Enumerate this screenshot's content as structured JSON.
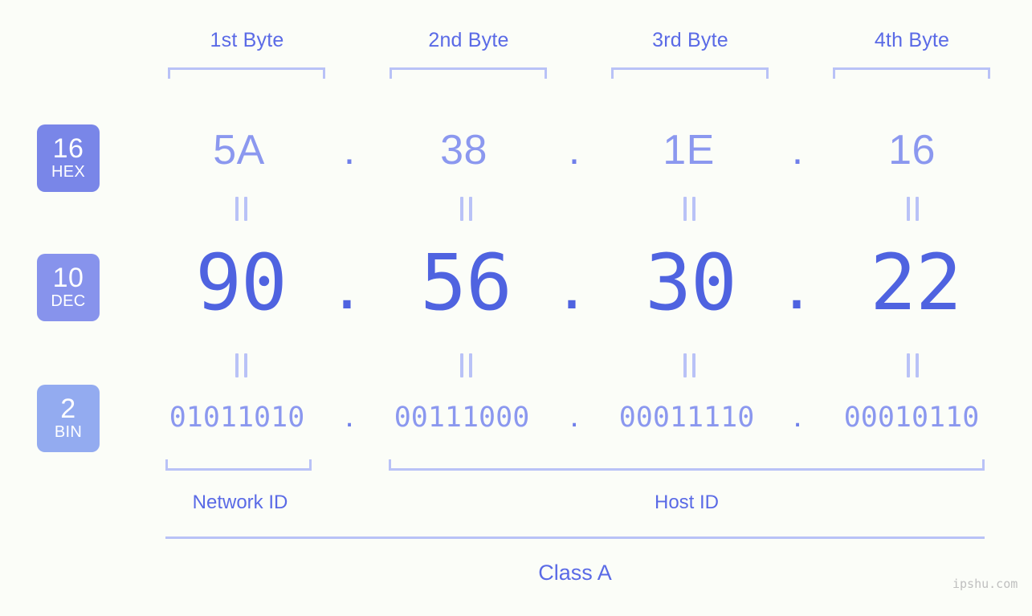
{
  "page": {
    "background_color": "#fbfdf8",
    "accent_color": "#5a6ae6",
    "muted_accent_color": "#8b98ef",
    "bracket_color": "#b9c2f7"
  },
  "byte_headers": [
    {
      "label": "1st Byte"
    },
    {
      "label": "2nd Byte"
    },
    {
      "label": "3rd Byte"
    },
    {
      "label": "4th Byte"
    }
  ],
  "rows": {
    "hex": {
      "badge_number": "16",
      "badge_system": "HEX",
      "badge_color": "#7986e8",
      "octets": [
        "5A",
        "38",
        "1E",
        "16"
      ],
      "separator": "."
    },
    "dec": {
      "badge_number": "10",
      "badge_system": "DEC",
      "badge_color": "#8793ec",
      "octets": [
        "90",
        "56",
        "30",
        "22"
      ],
      "separator": "."
    },
    "bin": {
      "badge_number": "2",
      "badge_system": "BIN",
      "badge_color": "#93abf0",
      "octets": [
        "01011010",
        "00111000",
        "00011110",
        "00010110"
      ],
      "separator": "."
    }
  },
  "equality_marks": {
    "symbol": "=",
    "count_per_row": 4,
    "rows": 2
  },
  "footer": {
    "network_id_label": "Network ID",
    "host_id_label": "Host ID",
    "class_label": "Class A"
  },
  "watermark": {
    "text": "ipshu.com"
  }
}
